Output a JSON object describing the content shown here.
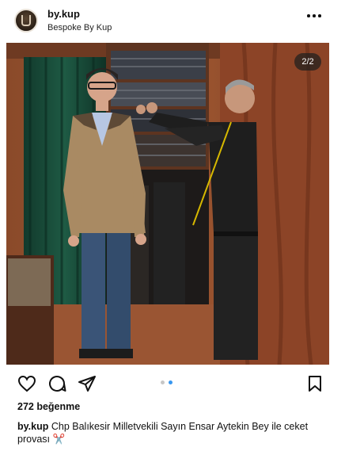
{
  "post": {
    "username": "by.kup",
    "account_name": "Bespoke By Kup",
    "more_icon": "more-horizontal-icon",
    "image_counter": "2/2",
    "likes": "272 beğenme",
    "caption_user": "by.kup",
    "caption_text": "Chp Balıkesir Milletvekili Sayın Ensar Aytekin Bey ile ceket provası",
    "caption_emoji": "✂️",
    "carousel": {
      "total": 2,
      "active_index": 2
    }
  },
  "actions": {
    "like_icon": "heart-outline-icon",
    "comment_icon": "comment-bubble-icon",
    "share_icon": "send-paper-plane-icon",
    "save_icon": "bookmark-outline-icon"
  },
  "colors": {
    "text": "#111111",
    "dot_active": "#3897f0",
    "dot_inactive": "#c7c7c7",
    "counter_bg": "#1e1e1e"
  }
}
